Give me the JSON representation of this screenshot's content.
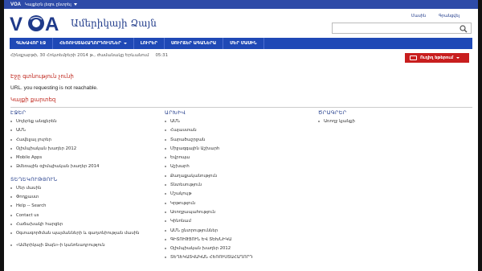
{
  "topbar": {
    "brand": "VOA",
    "language_selector": "Կայքերն լեզու ընտրել"
  },
  "header": {
    "logo_text": "VOA",
    "site_name": "Ամերիկայի Ձայն",
    "links": [
      "Մասին",
      "Գրանցվել"
    ],
    "search": {
      "placeholder": ""
    }
  },
  "nav": {
    "items": [
      {
        "label": "ԳԼԽԱՎՈՐ ԷՋ",
        "dropdown": false
      },
      {
        "label": "ՀԵՌՈՒՍՏԱՀԱՂՈՐԴՈՒՄՆԵՐ",
        "dropdown": true
      },
      {
        "label": "ԼՈՒՐԵՐ",
        "dropdown": false
      },
      {
        "label": "ՍՈՒՐՃԵՐ ԱԳԱՆԵՐԱ",
        "dropdown": false
      },
      {
        "label": "ՄԵՐ ՄԱՍԻՆ",
        "dropdown": false
      }
    ]
  },
  "dateline": {
    "date": "Հինգշաբթի, 30 Հոկտեմբերի 2014 թ., Ժամանակը Երևանում",
    "time": "05:31"
  },
  "live_button": {
    "label": "Ուղիղ եթերում"
  },
  "error": {
    "title": "Էջը գտնություն չունի",
    "message": "URL. you requesting is not reachable.",
    "links_title": "Կայքի քարտեզ"
  },
  "columns": {
    "col1": {
      "heading": "ԷՋԵՐ",
      "items": [
        "Սոլերեք անգլերեն",
        "ԱՄՆ",
        "Հավելյալ լուրեր",
        "Օլիմպիական խաղեր 2012",
        "Mobile Apps",
        "Ձմեռային օլիմպիական խաղեր 2014"
      ],
      "heading2": "ՏԵՂԵԿՈՒԹՅՈՒՆ",
      "items2": [
        "Մեր մասին",
        "Փոդքաստ",
        "Help -- Search",
        "Contact us",
        "Հաճախակի հարցեր",
        "Օգտագործման պայմանների և գաղտնիության մասին",
        "«Ամերիկայի Ձայն»-ի կանոնադրություն"
      ]
    },
    "col2": {
      "heading": "ԱՐԽԻՎ",
      "items": [
        "ԱՄՆ",
        "Հայաստան",
        "Տարածաշրջան",
        "Միջազգային Աշխարհ",
        "Եվրոպա",
        "Աշխարհ",
        "Քաղաքականություն",
        "Տնտեսություն",
        "Մշակույթ",
        "Կրթություն",
        "Առողջապահություն",
        "Կինոնամ",
        "ԱՄՆ ընտրություններ",
        "ԳԻՏՈՒԹՅՈՒՆ ԵՎ ՏԵԽՆԻԿԱ",
        "Օլիմպիական խաղեր 2012",
        "ՏԵՂԵԿԱՏՎԱԿԱՆ ՀԵՌՈՒՍՏԱՀԱՂՈՐԴ"
      ]
    },
    "col3": {
      "heading": "ԾՐԱԳՐԵՐ",
      "items": [
        "Առողջ կյանքի"
      ]
    }
  }
}
